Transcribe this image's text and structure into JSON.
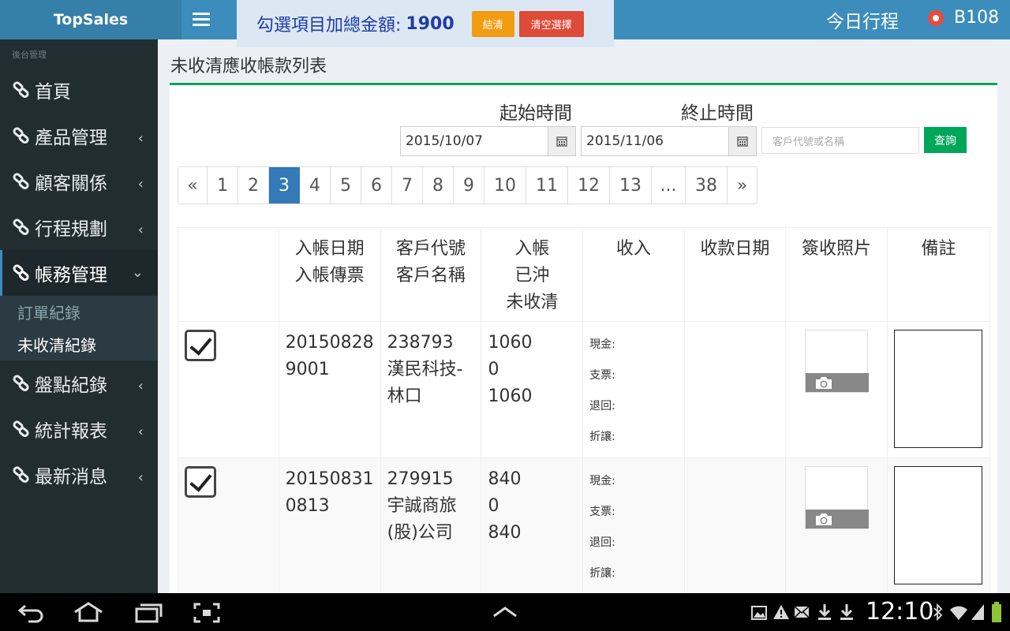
{
  "app": {
    "brand": "TopSales"
  },
  "header": {
    "sum_label": "勾選項目加總金額:",
    "sum_value": "1900",
    "settle_label": "結清",
    "clear_label": "清空選擇",
    "today_label": "今日行程",
    "user_code": "B108"
  },
  "sidebar": {
    "header": "後台管理",
    "items": [
      {
        "label": "首頁"
      },
      {
        "label": "產品管理"
      },
      {
        "label": "顧客關係"
      },
      {
        "label": "行程規劃"
      },
      {
        "label": "帳務管理"
      },
      {
        "label": "盤點紀錄"
      },
      {
        "label": "統計報表"
      },
      {
        "label": "最新消息"
      }
    ],
    "sub": [
      {
        "label": "訂單紀錄"
      },
      {
        "label": "未收清紀錄"
      }
    ]
  },
  "page": {
    "title": "未收清應收帳款列表",
    "start_label": "起始時間",
    "end_label": "終止時間",
    "start_date": "2015/10/07",
    "end_date": "2015/11/06",
    "search_placeholder": "客戶代號或名稱",
    "query_label": "查詢"
  },
  "pagination": {
    "prev": "«",
    "pages": [
      "1",
      "2",
      "3",
      "4",
      "5",
      "6",
      "7",
      "8",
      "9",
      "10",
      "11",
      "12",
      "13",
      "...",
      "38"
    ],
    "current": "3",
    "next": "»"
  },
  "table": {
    "headers": {
      "date": [
        "入帳日期",
        "入帳傳票"
      ],
      "customer": [
        "客戶代號",
        "客戶名稱"
      ],
      "amount": [
        "入帳",
        "已沖",
        "未收清"
      ],
      "income": "收入",
      "pay_date": "收款日期",
      "photo": "簽收照片",
      "note": "備註"
    },
    "income_labels": [
      "現金:",
      "支票:",
      "退回:",
      "折讓:"
    ],
    "rows": [
      {
        "checked": true,
        "date_line1": "20150828",
        "date_line2": "9001",
        "cust_line1": "238793",
        "cust_line2": "漢民科技-",
        "cust_line3": "林口",
        "amt_line1": "1060",
        "amt_line2": "0",
        "amt_line3": "1060"
      },
      {
        "checked": true,
        "date_line1": "20150831",
        "date_line2": "0813",
        "cust_line1": "279915",
        "cust_line2": "宇誠商旅",
        "cust_line3": "(股)公司",
        "amt_line1": "840",
        "amt_line2": "0",
        "amt_line3": "840"
      }
    ]
  },
  "statusbar": {
    "time": "12:10"
  }
}
